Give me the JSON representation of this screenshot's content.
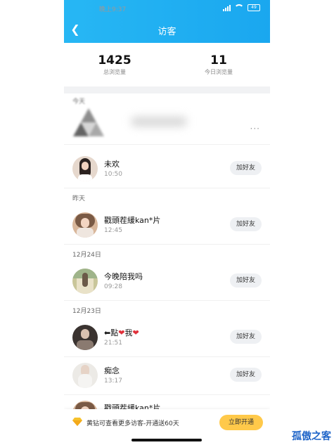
{
  "status_bar": {
    "time": "晚上9:37",
    "battery": "49"
  },
  "header": {
    "title": "访客"
  },
  "stats": {
    "total": {
      "value": "1425",
      "label": "总浏览量"
    },
    "today": {
      "value": "11",
      "label": "今日浏览量"
    }
  },
  "sections": {
    "today": "今天",
    "yesterday": "昨天",
    "dec24": "12月24日",
    "dec23": "12月23日"
  },
  "visitors": [
    {
      "name": "未欢",
      "time": "10:50",
      "action": "加好友"
    },
    {
      "name": "戳頭茬緩kan*片",
      "time": "12:45",
      "action": "加好友"
    },
    {
      "name": "今晚陪我吗",
      "time": "09:28",
      "action": "加好友"
    },
    {
      "name_prefix": "⬅點",
      "name_middle": "我",
      "time": "21:51",
      "action": "加好友"
    },
    {
      "name": "痴念",
      "time": "13:17",
      "action": "加好友"
    },
    {
      "name": "戳頭茬緩kan*片",
      "time": "",
      "action": ""
    }
  ],
  "banner": {
    "text": "黄钻可查看更多访客-开通送60天",
    "button": "立即开通"
  },
  "watermark": "孤傲之客",
  "colors": {
    "header": "#1aa7ef",
    "accent_button": "#ffc94a",
    "heart": "#e0313b"
  }
}
